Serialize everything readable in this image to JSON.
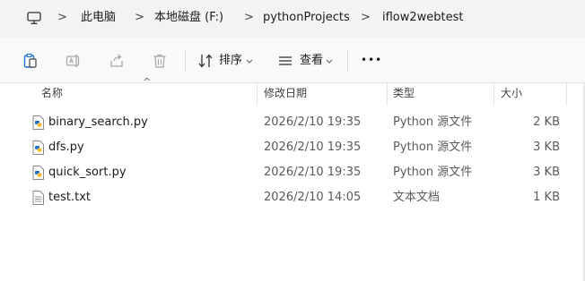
{
  "breadcrumb": {
    "items": [
      "此电脑",
      "本地磁盘 (F:)",
      "pythonProjects",
      "iflow2webtest"
    ],
    "separator": ">"
  },
  "toolbar": {
    "icons": [
      "clipboard-icon",
      "rename-icon",
      "share-icon",
      "delete-icon"
    ],
    "sort_label": "排序",
    "view_label": "查看",
    "more_label": "•••"
  },
  "columns": {
    "name": "名称",
    "modified": "修改日期",
    "type": "类型",
    "size": "大小",
    "sort_indicator": "^"
  },
  "files": [
    {
      "name": "binary_search.py",
      "modified": "2026/2/10 19:35",
      "type": "Python 源文件",
      "size": "2 KB",
      "icon": "python-file-icon"
    },
    {
      "name": "dfs.py",
      "modified": "2026/2/10 19:35",
      "type": "Python 源文件",
      "size": "3 KB",
      "icon": "python-file-icon"
    },
    {
      "name": "quick_sort.py",
      "modified": "2026/2/10 19:35",
      "type": "Python 源文件",
      "size": "3 KB",
      "icon": "python-file-icon"
    },
    {
      "name": "test.txt",
      "modified": "2026/2/10 14:05",
      "type": "文本文档",
      "size": "1 KB",
      "icon": "text-file-icon"
    }
  ],
  "colors": {
    "accent": "#1e6fd8",
    "python_yellow": "#f2c12e"
  }
}
